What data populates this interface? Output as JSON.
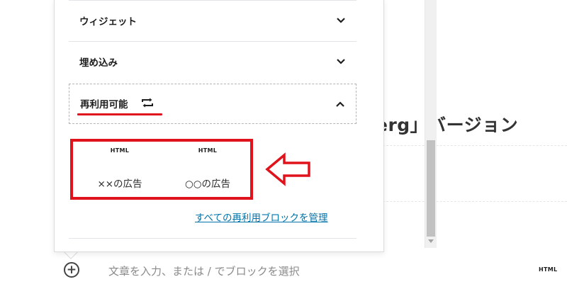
{
  "editor": {
    "heading_fragment": "erg」バージョン",
    "placeholder": "文章を入力、または / でブロックを選択",
    "html_label": "HTML"
  },
  "inserter": {
    "sections": {
      "widgets": "ウィジェット",
      "embeds": "埋め込み",
      "reusable": "再利用可能"
    },
    "reusable_blocks": [
      {
        "icon_label": "HTML",
        "title": "××の広告"
      },
      {
        "icon_label": "HTML",
        "title": "○○の広告"
      }
    ],
    "manage_link": "すべての再利用ブロックを管理"
  },
  "colors": {
    "annotation_red": "#e0121c",
    "link_blue": "#0073aa",
    "text": "#1e1e1e"
  },
  "icons": {
    "widgets_chevron": "chevron-down-icon",
    "embeds_chevron": "chevron-down-icon",
    "reusable_chevron": "chevron-up-icon",
    "reusable": "reusable-block-icon",
    "add": "plus-circle-icon",
    "annotation": "left-arrow-icon"
  }
}
